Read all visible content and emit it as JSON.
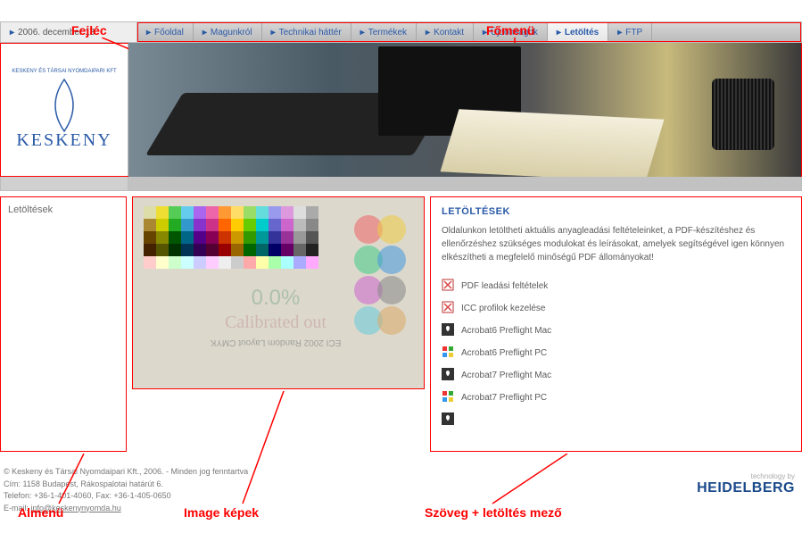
{
  "annotations": {
    "fejlec": "Fejléc",
    "fomenu": "Főmenü",
    "almenu": "Almenü",
    "image_kepek": "Image képek",
    "szoveg_mezo": "Szöveg + letöltés mező"
  },
  "header": {
    "date": "2006. december 13.",
    "logo_top": "KESKENY ÉS TÁRSAI NYOMDAIPARI KFT",
    "logo_main": "KESKENY"
  },
  "menu": [
    {
      "label": "Főoldal",
      "active": false
    },
    {
      "label": "Magunkról",
      "active": false
    },
    {
      "label": "Technikai háttér",
      "active": false
    },
    {
      "label": "Termékek",
      "active": false
    },
    {
      "label": "Kontakt",
      "active": false
    },
    {
      "label": "Újdonságok",
      "active": false
    },
    {
      "label": "Letöltés",
      "active": true
    },
    {
      "label": "FTP",
      "active": false
    }
  ],
  "submenu": {
    "title": "Letöltések"
  },
  "content": {
    "title": "LETÖLTÉSEK",
    "intro": "Oldalunkon letöltheti aktuális anyagleadási feltételeinket, a PDF-készítéshez és ellenőrzéshez szükséges modulokat és leírásokat, amelyek segítségével igen könnyen elkészítheti a megfelelő minőségű PDF állományokat!",
    "downloads": [
      {
        "icon": "pdf",
        "label": "PDF leadási feltételek"
      },
      {
        "icon": "pdf",
        "label": "ICC profilok kezelése"
      },
      {
        "icon": "mac",
        "label": "Acrobat6 Preflight Mac"
      },
      {
        "icon": "win",
        "label": "Acrobat6 Preflight PC"
      },
      {
        "icon": "mac",
        "label": "Acrobat7 Preflight Mac"
      },
      {
        "icon": "win",
        "label": "Acrobat7 Preflight PC"
      },
      {
        "icon": "mac",
        "label": ""
      }
    ]
  },
  "footer": {
    "line1": "© Keskeny és Társai Nyomdaipari Kft., 2006. - Minden jog fenntartva",
    "line2": "Cím: 1158 Budapest, Rákospalotai határút 6.",
    "line3": "Telefon: +36-1-401-4060, Fax: +36-1-405-0650",
    "line4_prefix": "E-mail: ",
    "line4_link": "info@keskenynyomda.hu"
  },
  "tech": {
    "small": "technology by",
    "brand": "HEIDELBERG"
  },
  "swatch_colors": [
    "#dda",
    "#ed3",
    "#5c5",
    "#6ce",
    "#a6e",
    "#e6a",
    "#f93",
    "#fd6",
    "#9d6",
    "#6dd",
    "#99e",
    "#d9d",
    "#ddd",
    "#aaa",
    "#a83",
    "#cc0",
    "#2a2",
    "#39c",
    "#83c",
    "#c38",
    "#f60",
    "#fc0",
    "#6c0",
    "#0cc",
    "#66c",
    "#c6c",
    "#bbb",
    "#888",
    "#640",
    "#880",
    "#050",
    "#068",
    "#508",
    "#805",
    "#c30",
    "#c90",
    "#390",
    "#099",
    "#339",
    "#939",
    "#999",
    "#555",
    "#420",
    "#550",
    "#030",
    "#035",
    "#305",
    "#503",
    "#900",
    "#960",
    "#060",
    "#066",
    "#006",
    "#606",
    "#666",
    "#222",
    "#fcc",
    "#ffc",
    "#cfc",
    "#cff",
    "#ccf",
    "#fcf",
    "#eee",
    "#ccc",
    "#faa",
    "#ffa",
    "#afa",
    "#aff",
    "#aaf",
    "#faf"
  ]
}
